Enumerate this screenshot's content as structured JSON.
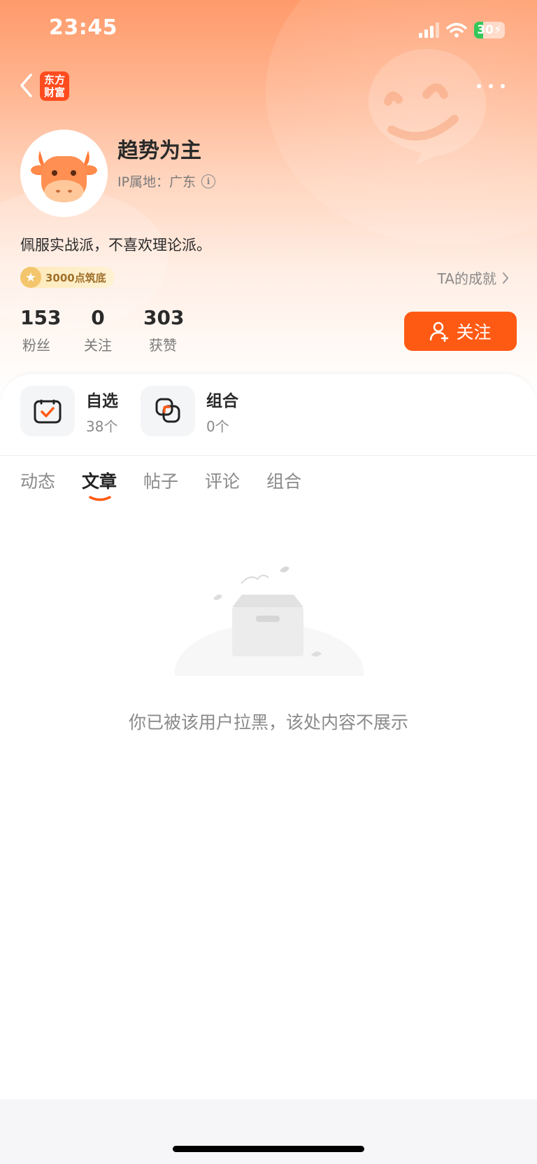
{
  "status_bar": {
    "time": "23:45",
    "battery": "30"
  },
  "header": {
    "logo_line1": "东方",
    "logo_line2": "财富"
  },
  "profile": {
    "name": "趋势为主",
    "ip_location": "IP属地：广东",
    "bio": "佩服实战派，不喜欢理论派。",
    "badge": "3000点筑底",
    "achievement_link": "TA的成就"
  },
  "stats": [
    {
      "value": "153",
      "label": "粉丝"
    },
    {
      "value": "0",
      "label": "关注"
    },
    {
      "value": "303",
      "label": "获赞"
    }
  ],
  "follow_button": "关注",
  "tools": [
    {
      "title": "自选",
      "count": "38个"
    },
    {
      "title": "组合",
      "count": "0个"
    }
  ],
  "tabs": [
    "动态",
    "文章",
    "帖子",
    "评论",
    "组合"
  ],
  "active_tab": "文章",
  "empty_message": "你已被该用户拉黑，该处内容不展示",
  "colors": {
    "accent": "#ff5a14",
    "hero_top": "#ff9a6a",
    "text_gray": "#8a8a8a"
  },
  "icons": [
    "signal-icon",
    "wifi-icon",
    "battery-icon",
    "back-arrow-icon",
    "more-icon",
    "info-icon",
    "chevron-right-icon",
    "add-user-icon",
    "watchlist-icon",
    "portfolio-icon",
    "medal-icon",
    "empty-box-icon"
  ]
}
